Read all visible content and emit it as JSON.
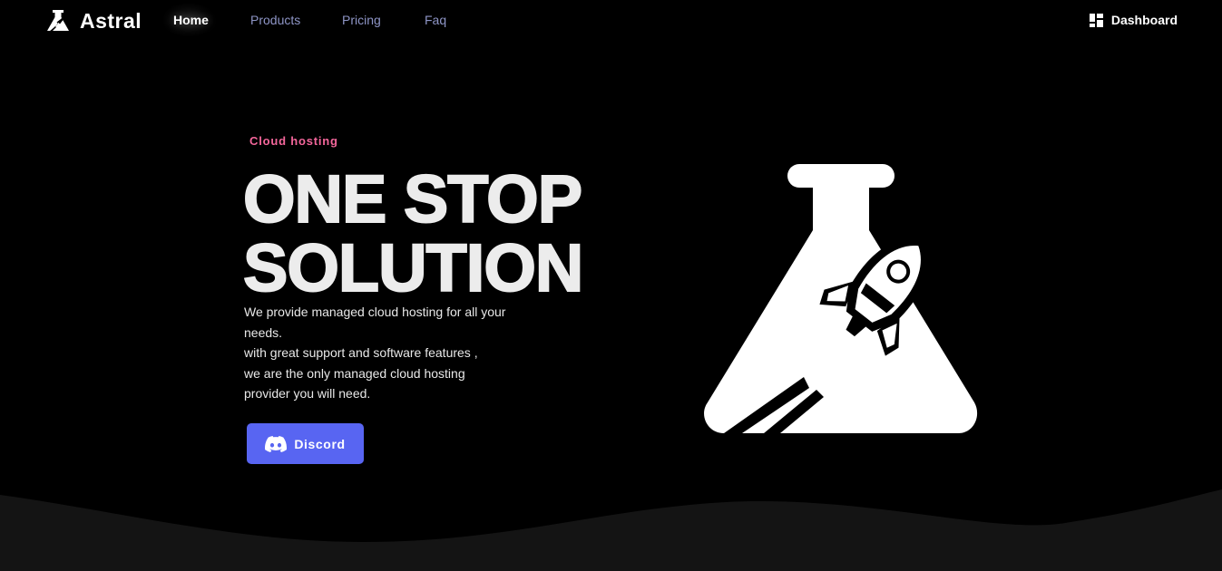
{
  "brand": {
    "name": "Astral",
    "icon": "astral-logo-icon"
  },
  "nav": {
    "items": [
      {
        "label": "Home",
        "active": true
      },
      {
        "label": "Products",
        "active": false
      },
      {
        "label": "Pricing",
        "active": false
      },
      {
        "label": "Faq",
        "active": false
      }
    ],
    "dashboard": {
      "label": "Dashboard",
      "icon": "dashboard-icon"
    }
  },
  "hero": {
    "eyebrow": "Cloud hosting",
    "title_line1": "ONE STOP",
    "title_line2": "SOLUTION",
    "description_lines": [
      "We provide managed cloud hosting for all your",
      "needs.",
      "with great support and software features ,",
      "we are the only managed cloud hosting",
      "provider you will need."
    ],
    "cta": {
      "label": "Discord",
      "icon": "discord-icon"
    },
    "illustration": "flask-rocket-icon"
  },
  "colors": {
    "background": "#000000",
    "accent_pink": "#f4669b",
    "discord_blurple": "#5865f2",
    "nav_link": "#8e95c6",
    "wave": "#141414"
  }
}
